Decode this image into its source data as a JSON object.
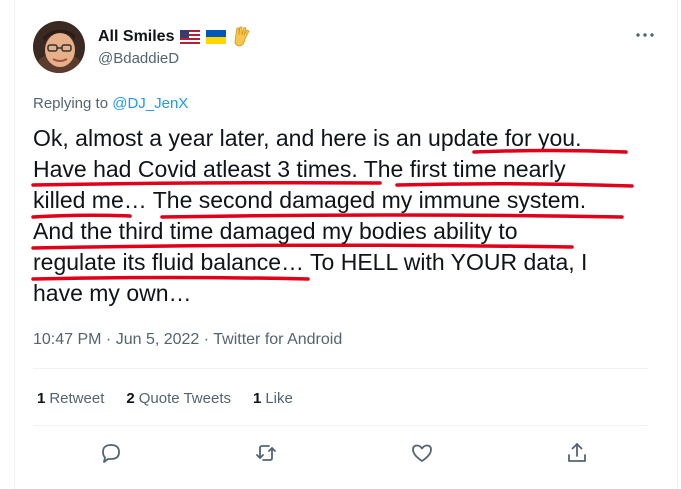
{
  "author": {
    "name": "All Smiles",
    "handle": "@BdaddieD",
    "emoji": [
      "us-flag-icon",
      "ukraine-flag-icon",
      "vulcan-salute-icon"
    ]
  },
  "reply": {
    "prefix": "Replying to ",
    "to": "@DJ_JenX"
  },
  "tweet": {
    "lines": [
      "Ok, almost a year later, and here is an update for you.",
      "Have had Covid atleast 3 times. The first time nearly",
      "killed me… The second damaged my immune system.",
      "And the third time damaged my bodies ability to",
      "regulate its fluid balance… To HELL with YOUR data, I",
      "have my own…"
    ]
  },
  "meta": {
    "time": "10:47 PM",
    "date": "Jun 5, 2022",
    "client": "Twitter for Android",
    "separator": " · "
  },
  "stats": {
    "retweets_count": "1",
    "retweets_label": "Retweet",
    "quotes_count": "2",
    "quotes_label": "Quote Tweets",
    "likes_count": "1",
    "likes_label": "Like"
  },
  "actions": [
    "reply-icon",
    "retweet-icon",
    "like-icon",
    "share-icon"
  ],
  "colors": {
    "accent": "#1d9bf0",
    "secondary_text": "#536471",
    "annotation_underline": "#e0001a"
  }
}
